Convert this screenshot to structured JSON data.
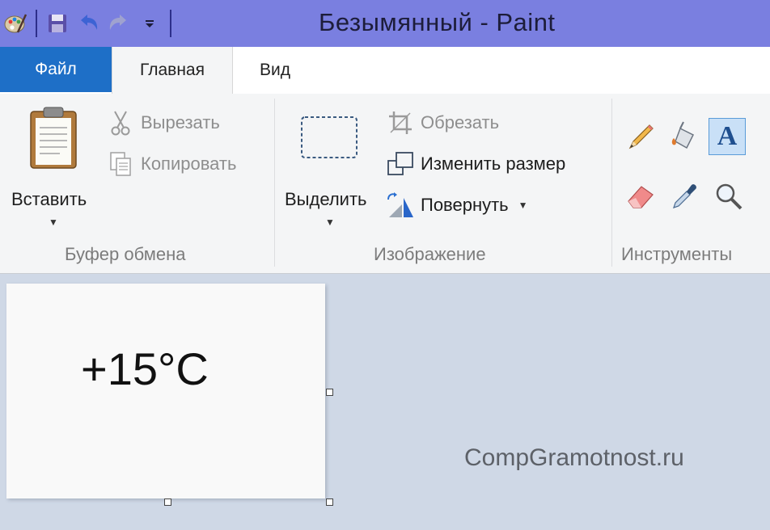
{
  "window": {
    "title": "Безымянный - Paint"
  },
  "quick_access": {
    "app_icon": "paint-palette-icon",
    "save_icon": "save-icon",
    "undo_icon": "undo-icon",
    "redo_icon": "redo-icon",
    "customize_icon": "customize-dropdown-icon"
  },
  "tabs": {
    "file": "Файл",
    "home": "Главная",
    "view": "Вид",
    "active": "Главная"
  },
  "ribbon": {
    "clipboard": {
      "label": "Буфер обмена",
      "paste": "Вставить",
      "cut": "Вырезать",
      "copy": "Копировать"
    },
    "image": {
      "label": "Изображение",
      "select": "Выделить",
      "crop": "Обрезать",
      "resize": "Изменить размер",
      "rotate": "Повернуть"
    },
    "tools": {
      "label": "Инструменты",
      "items": [
        "pencil-icon",
        "fill-bucket-icon",
        "text-tool-icon",
        "eraser-icon",
        "color-picker-icon",
        "magnifier-icon"
      ],
      "text_tool_glyph": "A",
      "active": "text-tool-icon"
    }
  },
  "canvas": {
    "text": "+15°C"
  },
  "watermark": "CompGramotnost.ru",
  "colors": {
    "titlebar": "#7a7fe0",
    "file_tab": "#1e6fc7",
    "workspace": "#cfd8e6"
  }
}
